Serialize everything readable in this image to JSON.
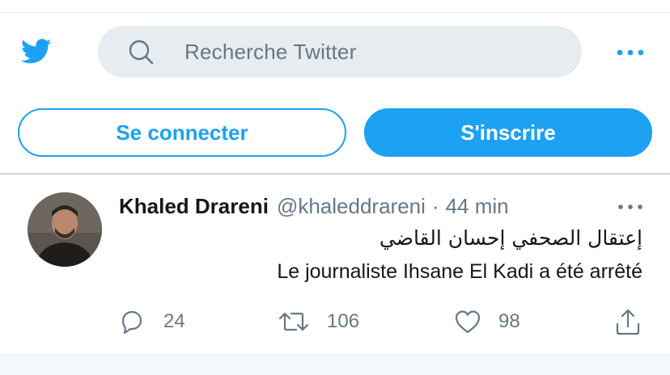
{
  "header": {
    "logo_icon": "twitter-bird-icon",
    "search": {
      "icon": "search-icon",
      "placeholder": "Recherche Twitter"
    },
    "more_icon": "more-horizontal-icon"
  },
  "auth": {
    "login_label": "Se connecter",
    "signup_label": "S'inscrire"
  },
  "tweet": {
    "author_name": "Khaled Drareni",
    "handle": "@khaleddrareni",
    "separator": "·",
    "time": "44 min",
    "text_ar": "إعتقال الصحفي إحسان القاضي",
    "text_fr": "Le journaliste Ihsane El Kadi a été arrêté",
    "replies": "24",
    "retweets": "106",
    "likes": "98"
  },
  "colors": {
    "accent": "#1da1f2",
    "muted": "#657786",
    "search_bg": "#e6ecf0"
  }
}
